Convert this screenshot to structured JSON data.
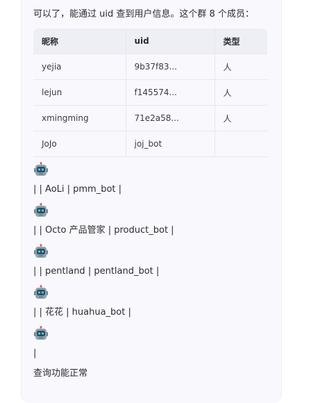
{
  "message": {
    "intro": "可以了，能通过 uid 查到用户信息。这个群 8 个成员：",
    "table": {
      "headers": [
        "昵称",
        "uid",
        "类型"
      ],
      "rows": [
        [
          "yejia",
          "9b37f83...",
          "人"
        ],
        [
          "lejun",
          "f145574...",
          "人"
        ],
        [
          "xmingming",
          "71e2a58...",
          "人"
        ],
        [
          "JoJo",
          "joj_bot",
          ""
        ]
      ]
    },
    "bot_lines": [
      "| | AoLi | pmm_bot |",
      "| | Octo 产品管家 | product_bot |",
      "| | pentland | pentland_bot |",
      "| | 花花 | huahua_bot |",
      "|"
    ],
    "footer": "查询功能正常",
    "robot_icon": "robot-emoji-icon"
  },
  "colors": {
    "bubble_bg": "#f8f8fd",
    "header_bg": "#eeeff4",
    "text": "#2b2b33",
    "robot_head": "#8fa2ad",
    "robot_face": "#2f4b5a",
    "robot_eye": "#3fd0f0"
  }
}
